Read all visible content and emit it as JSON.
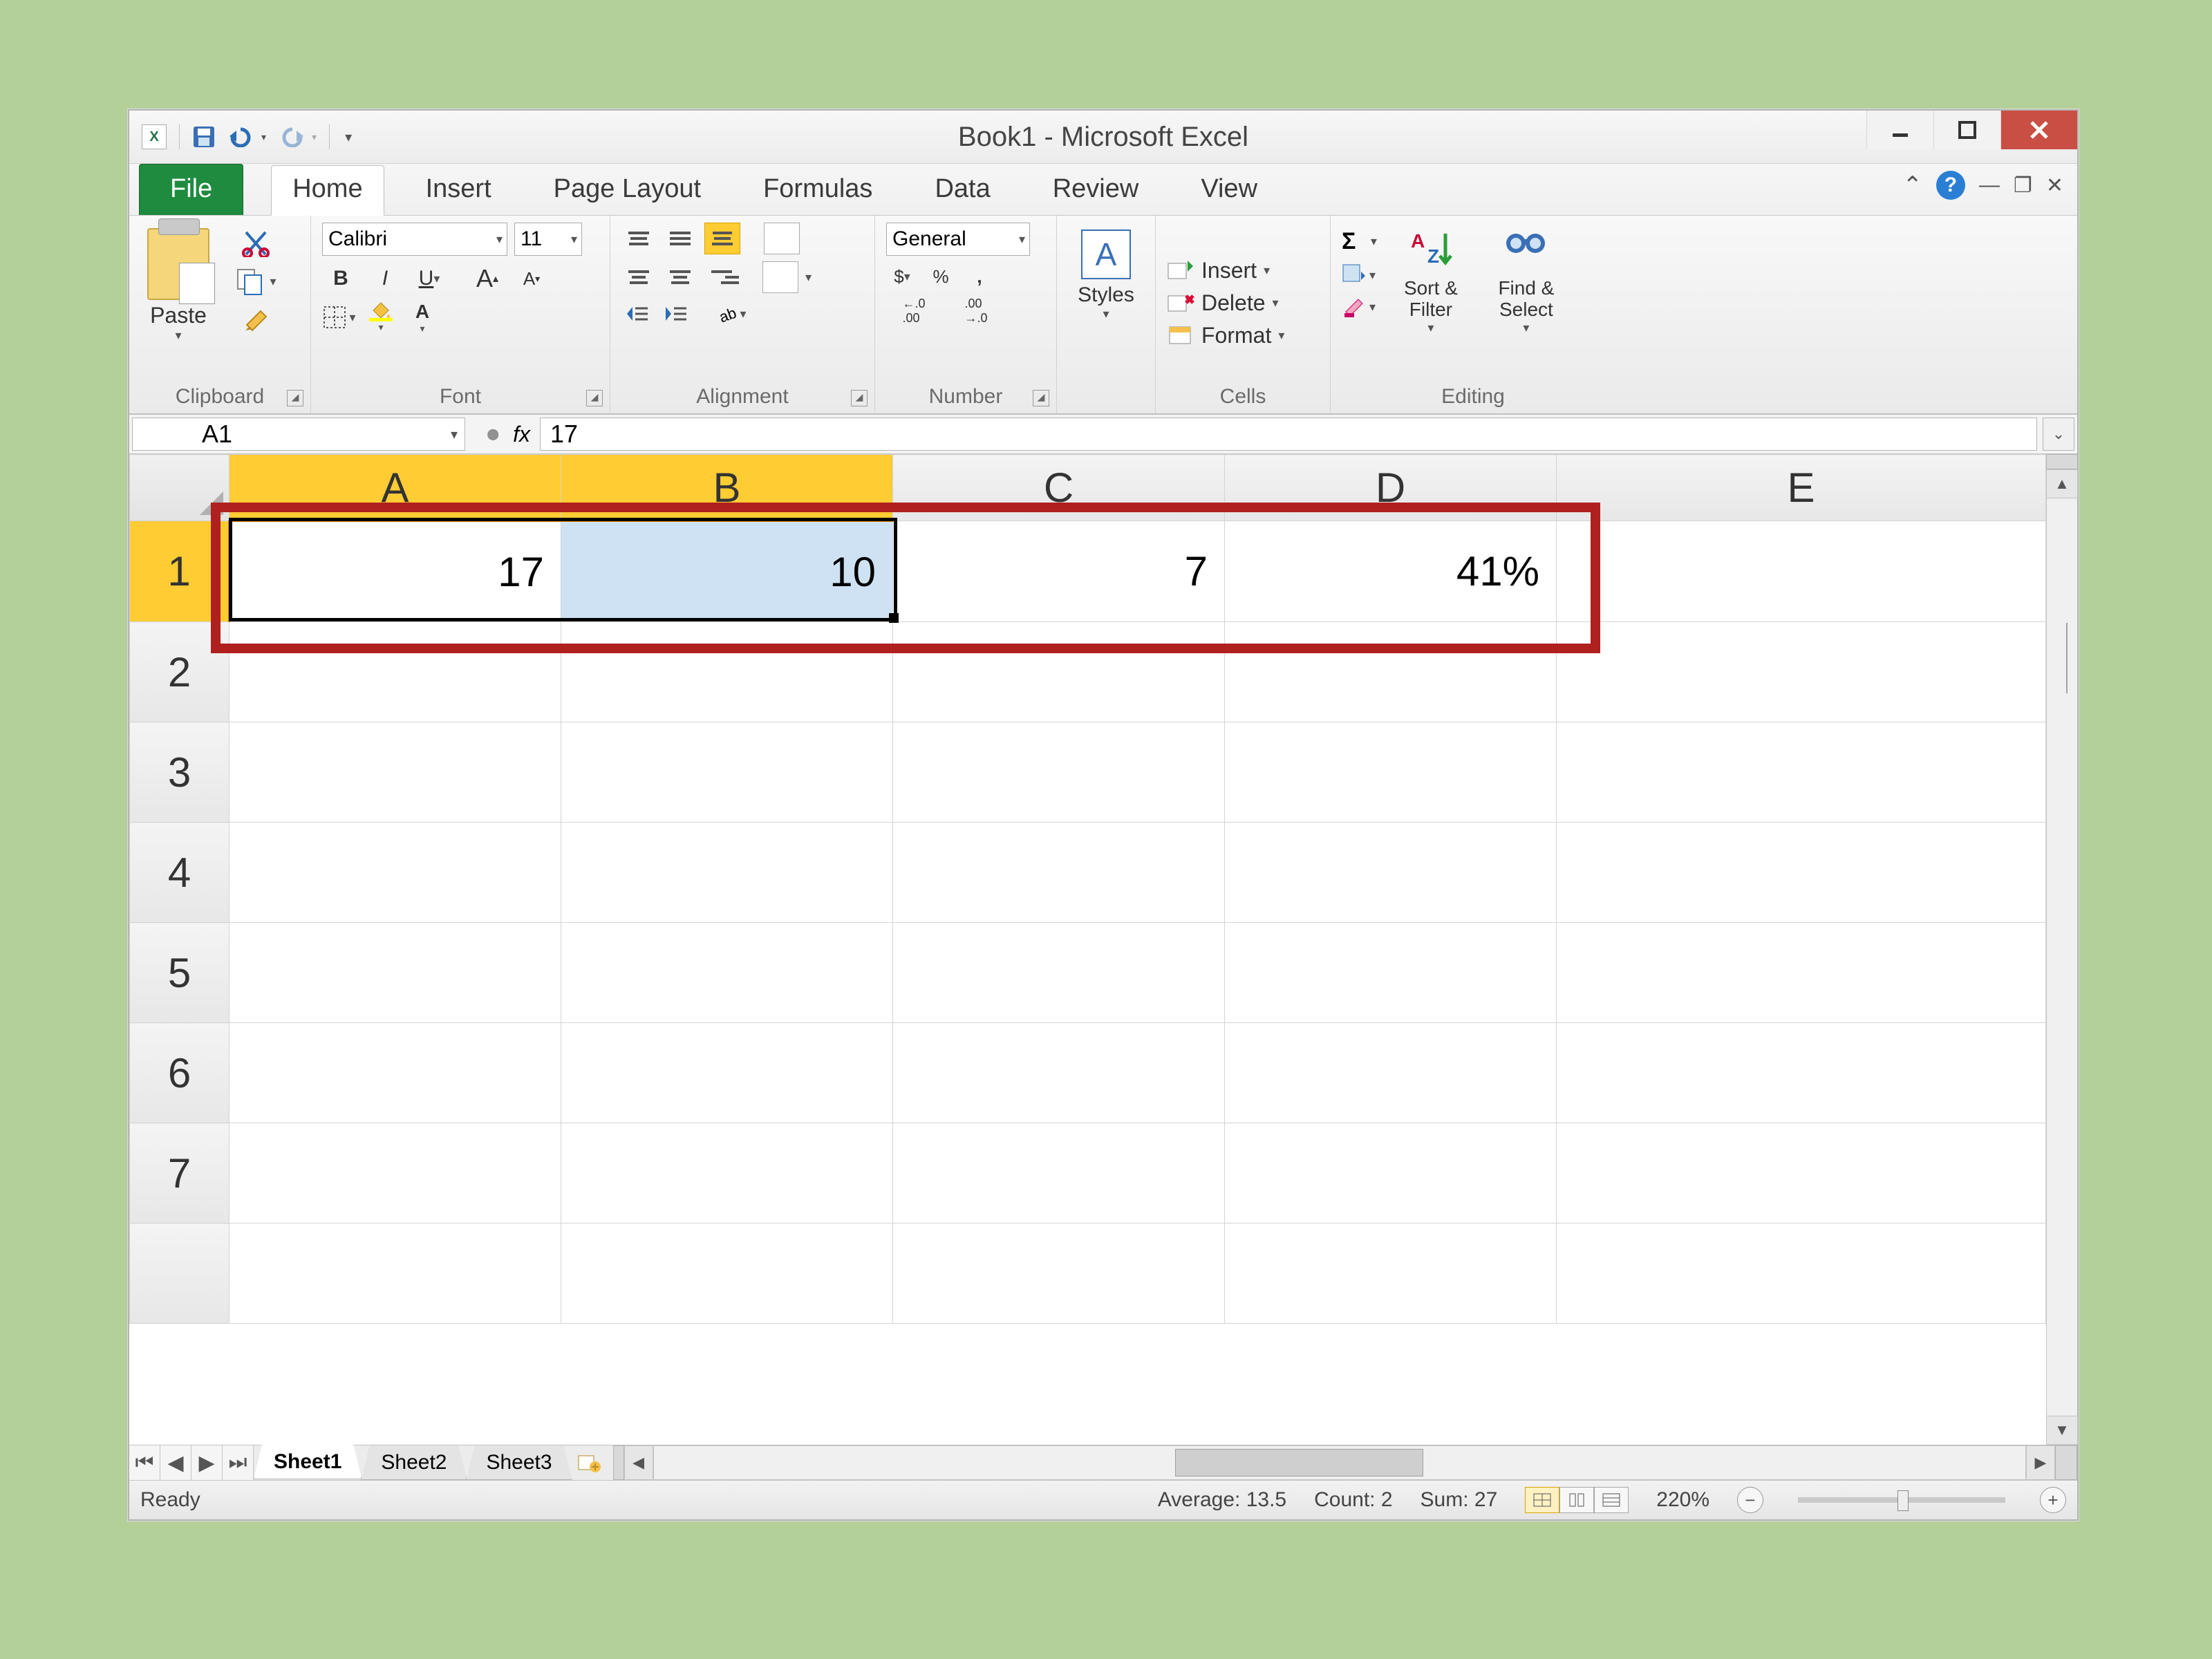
{
  "title": "Book1 - Microsoft Excel",
  "tabs": {
    "file": "File",
    "list": [
      "Home",
      "Insert",
      "Page Layout",
      "Formulas",
      "Data",
      "Review",
      "View"
    ],
    "active": "Home"
  },
  "ribbon": {
    "clipboard": {
      "label": "Clipboard",
      "paste": "Paste"
    },
    "font": {
      "label": "Font",
      "name": "Calibri",
      "size": "11",
      "bold": "B",
      "italic": "I",
      "underline": "U",
      "grow": "A",
      "shrink": "A"
    },
    "alignment": {
      "label": "Alignment"
    },
    "number": {
      "label": "Number",
      "format": "General",
      "currency": "$",
      "percent": "%",
      "comma": ",",
      "inc": "←.0 .00",
      "dec": ".00 →.0"
    },
    "styles": {
      "label": "",
      "btn": "Styles"
    },
    "cells": {
      "label": "Cells",
      "insert": "Insert",
      "delete": "Delete",
      "format": "Format"
    },
    "editing": {
      "label": "Editing",
      "sigma": "Σ",
      "sort": "Sort & Filter",
      "find": "Find & Select"
    }
  },
  "formula_bar": {
    "name_box": "A1",
    "fx": "fx",
    "value": "17"
  },
  "grid": {
    "columns": [
      "A",
      "B",
      "C",
      "D",
      "E"
    ],
    "rows": [
      "1",
      "2",
      "3",
      "4",
      "5",
      "6",
      "7"
    ],
    "selected_cols": [
      "A",
      "B"
    ],
    "selected_rows": [
      "1"
    ],
    "cells": {
      "A1": "17",
      "B1": "10",
      "C1": "7",
      "D1": "41%"
    }
  },
  "sheets": {
    "list": [
      "Sheet1",
      "Sheet2",
      "Sheet3"
    ],
    "active": "Sheet1"
  },
  "status": {
    "ready": "Ready",
    "average": "Average: 13.5",
    "count": "Count: 2",
    "sum": "Sum: 27",
    "zoom": "220%"
  }
}
